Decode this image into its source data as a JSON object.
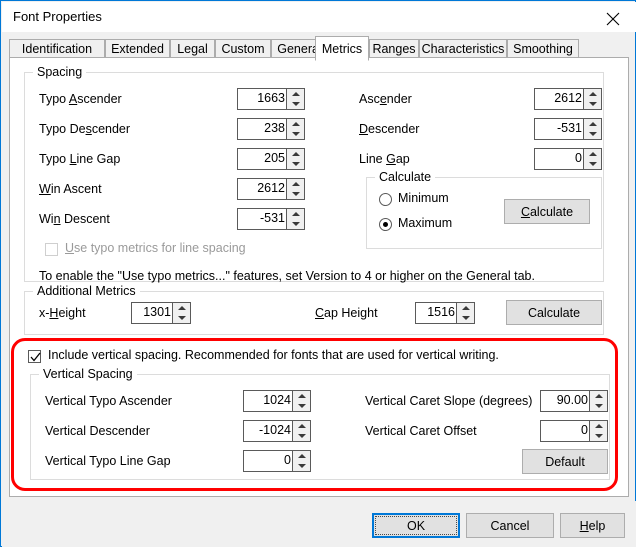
{
  "window": {
    "title": "Font Properties",
    "close_icon": "close-icon",
    "accent_color": "#0078d7",
    "highlight_color": "#ff0000"
  },
  "tabs": [
    {
      "label": "Identification",
      "active": false
    },
    {
      "label": "Extended",
      "active": false
    },
    {
      "label": "Legal",
      "active": false
    },
    {
      "label": "Custom",
      "active": false
    },
    {
      "label": "General",
      "active": false
    },
    {
      "label": "Metrics",
      "active": true
    },
    {
      "label": "Ranges",
      "active": false
    },
    {
      "label": "Characteristics",
      "active": false
    },
    {
      "label": "Smoothing",
      "active": false
    }
  ],
  "spacing": {
    "group_label": "Spacing",
    "rows": [
      {
        "label_pre": "Typo ",
        "label_accel": "A",
        "label_post": "scender",
        "value": "1663"
      },
      {
        "label_pre": "Typo De",
        "label_accel": "s",
        "label_post": "cender",
        "value": "238"
      },
      {
        "label_pre": "Typo ",
        "label_accel": "L",
        "label_post": "ine Gap",
        "value": "205"
      },
      {
        "label_pre": "",
        "label_accel": "W",
        "label_post": "in Ascent",
        "value": "2612"
      },
      {
        "label_pre": "Wi",
        "label_accel": "n",
        "label_post": " Descent",
        "value": "-531"
      }
    ],
    "use_typo_checkbox": {
      "label_pre": "",
      "label_accel": "U",
      "label_post": "se typo metrics for line spacing",
      "checked": false,
      "enabled": false
    }
  },
  "right_metrics": {
    "rows": [
      {
        "label_pre": "Asc",
        "label_accel": "e",
        "label_post": "nder",
        "value": "2612"
      },
      {
        "label_pre": "",
        "label_accel": "D",
        "label_post": "escender",
        "value": "-531"
      },
      {
        "label_pre": "Line ",
        "label_accel": "G",
        "label_post": "ap",
        "value": "0"
      }
    ]
  },
  "calculate_group": {
    "group_label": "Calculate",
    "options": [
      {
        "label": "Minimum",
        "selected": false
      },
      {
        "label": "Maximum",
        "selected": true
      }
    ],
    "button": {
      "pre": "",
      "accel": "C",
      "post": "alculate"
    }
  },
  "hint": "To enable the \"Use typo metrics...\" features, set Version to 4 or higher on the General tab.",
  "additional_metrics": {
    "group_label": "Additional Metrics",
    "x_height": {
      "label_pre": "x-",
      "label_accel": "H",
      "label_post": "eight",
      "value": "1301"
    },
    "cap_height": {
      "label_pre": "",
      "label_accel": "C",
      "label_post": "ap Height",
      "value": "1516"
    },
    "button": "Calculate"
  },
  "vertical": {
    "include_checkbox": {
      "label": "Include vertical spacing. Recommended for fonts that are used for vertical writing.",
      "checked": true
    },
    "group_label": "Vertical Spacing",
    "left_rows": [
      {
        "label": "Vertical Typo Ascender",
        "value": "1024"
      },
      {
        "label": "Vertical Descender",
        "value": "-1024"
      },
      {
        "label": "Vertical Typo Line Gap",
        "value": "0"
      }
    ],
    "right_rows": [
      {
        "label": "Vertical Caret Slope (degrees)",
        "value": "90.00"
      },
      {
        "label": "Vertical Caret Offset",
        "value": "0"
      }
    ],
    "default_button": "Default"
  },
  "footer": {
    "ok": "OK",
    "cancel": "Cancel",
    "help_pre": "",
    "help_accel": "H",
    "help_post": "elp"
  }
}
